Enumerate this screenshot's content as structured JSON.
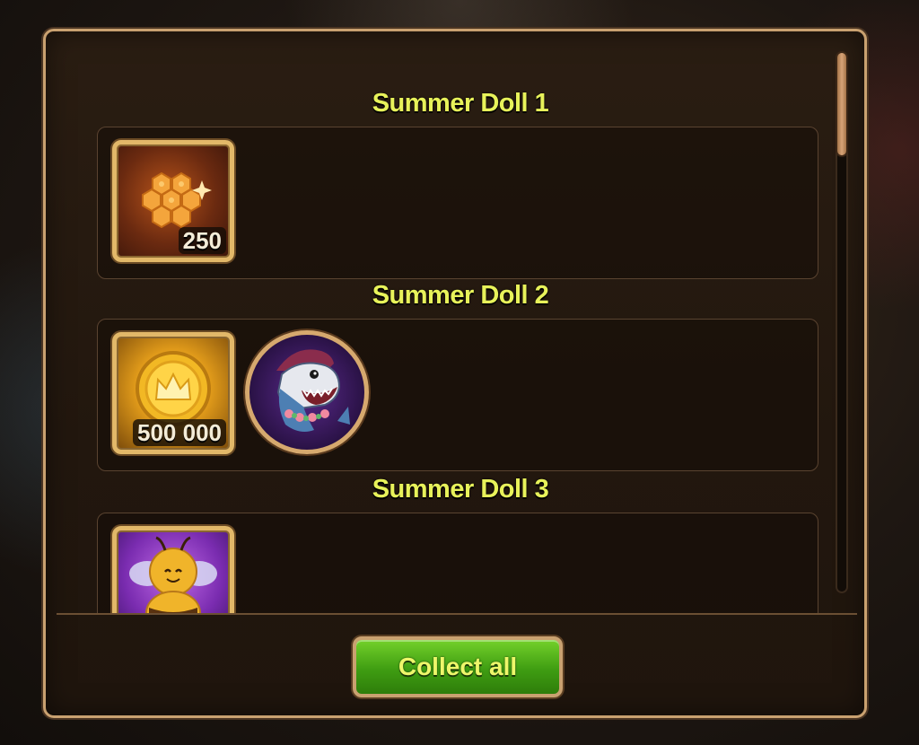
{
  "sections": [
    {
      "title": "Summer Doll 1",
      "rewards": [
        {
          "icon": "honeycomb-icon",
          "quantity": "250"
        }
      ]
    },
    {
      "title": "Summer Doll 2",
      "rewards": [
        {
          "icon": "gold-coin-icon",
          "quantity": "500 000"
        },
        {
          "icon": "shark-hero-avatar"
        }
      ]
    },
    {
      "title": "Summer Doll 3",
      "rewards": [
        {
          "icon": "bee-pet-icon"
        }
      ]
    }
  ],
  "button": {
    "label": "Collect all"
  },
  "colors": {
    "title": "#e8f25a",
    "frame": "#c9a170",
    "button": "#4ab01a"
  }
}
